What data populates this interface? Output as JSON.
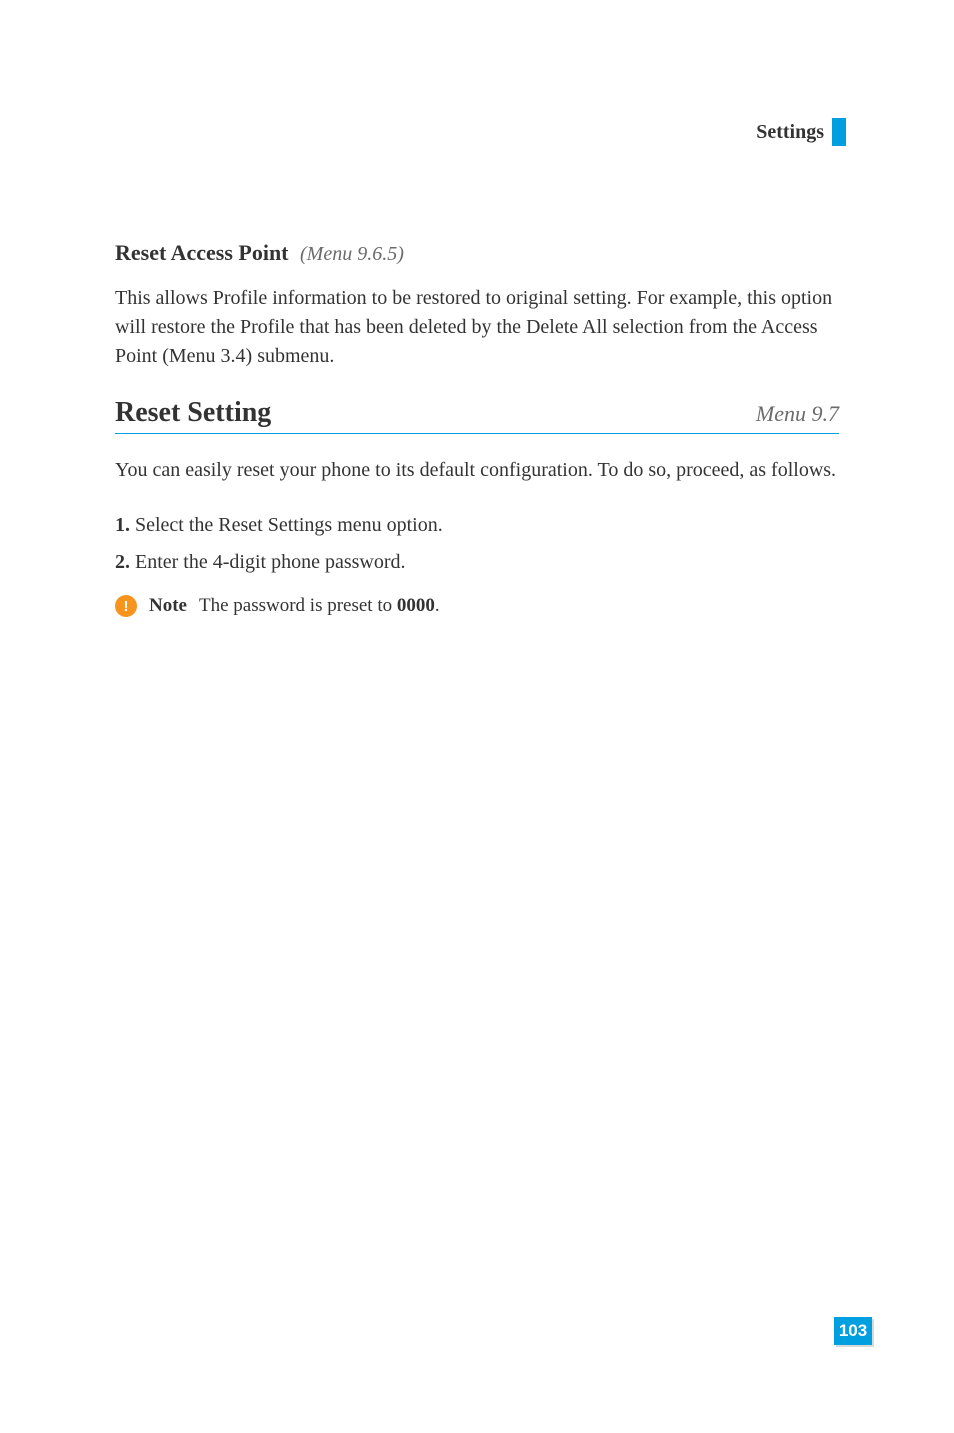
{
  "header": {
    "label": "Settings"
  },
  "subsection": {
    "title": "Reset Access Point",
    "menu_ref": "(Menu 9.6.5)",
    "body": "This allows Profile information to be restored to original setting. For example, this option will restore the Profile that has been deleted by the Delete All selection from the Access Point (Menu 3.4) submenu."
  },
  "section": {
    "title": "Reset Setting",
    "menu_label": "Menu 9.7",
    "intro": "You can easily reset your phone to its default configuration. To do so, proceed, as follows.",
    "steps": [
      {
        "num": "1.",
        "text": " Select the Reset Settings menu option."
      },
      {
        "num": "2.",
        "text": " Enter the 4-digit phone password."
      }
    ],
    "note": {
      "label": "Note",
      "text_prefix": "  The password is preset to ",
      "value": "0000",
      "text_suffix": "."
    }
  },
  "page_number": "103"
}
